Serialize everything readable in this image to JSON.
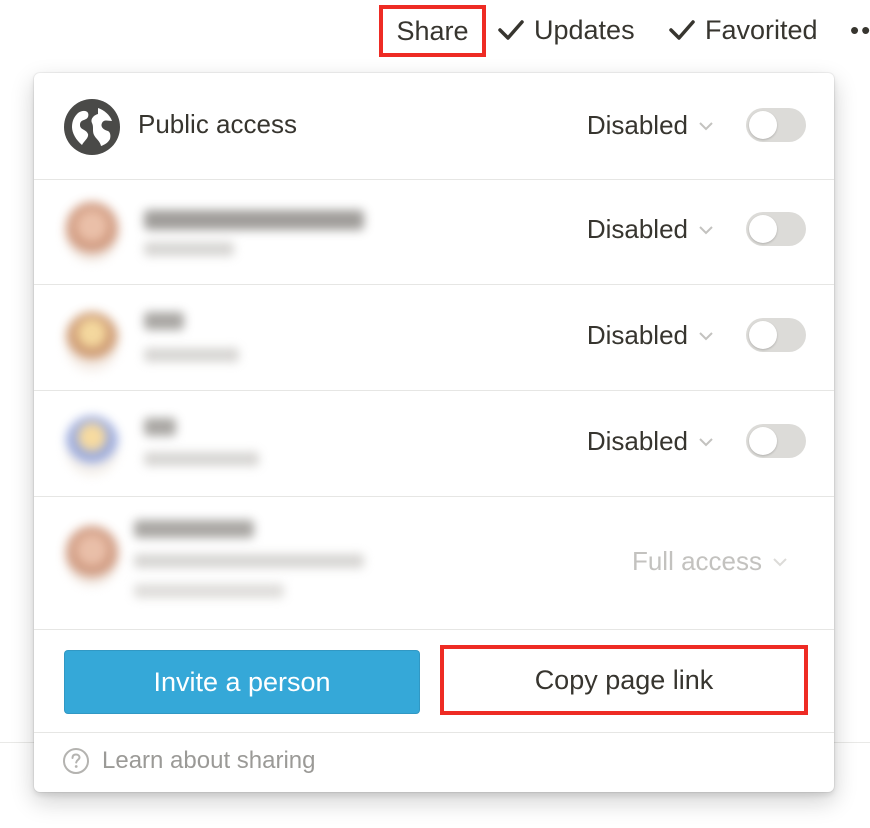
{
  "topbar": {
    "share_label": "Share",
    "updates_label": "Updates",
    "favorited_label": "Favorited",
    "more_label": "••"
  },
  "popup": {
    "public_access": {
      "label": "Public access",
      "permission": "Disabled",
      "toggle_on": false
    },
    "members": [
      {
        "permission": "Disabled",
        "toggle_on": false
      },
      {
        "permission": "Disabled",
        "toggle_on": false
      },
      {
        "permission": "Disabled",
        "toggle_on": false
      },
      {
        "permission": "Full access"
      }
    ],
    "invite_label": "Invite a person",
    "copy_link_label": "Copy page link",
    "learn_label": "Learn about sharing"
  },
  "colors": {
    "invite_button": "#35a8d8",
    "highlight_box": "#ee2b24",
    "toggle_off": "#dcdbd8",
    "text": "#37352f",
    "muted_text": "#9b9a97"
  },
  "icons": [
    "check-icon",
    "globe-icon",
    "chevron-down-icon",
    "help-circle-icon",
    "more-icon"
  ]
}
